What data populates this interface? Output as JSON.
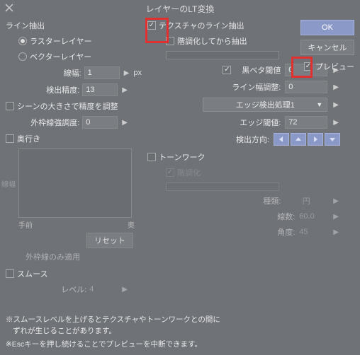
{
  "title": "レイヤーのLT変換",
  "buttons": {
    "ok": "OK",
    "cancel": "キャンセル",
    "preview": "プレビュー",
    "reset": "リセット",
    "outlineOnly": "外枠線のみ適用"
  },
  "left": {
    "section": "ライン抽出",
    "rasterLayer": "ラスターレイヤー",
    "vectorLayer": "ベクターレイヤー",
    "lineWidth": "線幅:",
    "lineWidthVal": "1",
    "lineWidthUnit": "px",
    "detectAccuracy": "検出精度:",
    "detectAccuracyVal": "13",
    "sceneSize": "シーンの大きさで精度を調整",
    "outlineStrength": "外枠線強調度:",
    "outlineStrengthVal": "0",
    "depth": "奥行き",
    "graphY": "線幅",
    "graphXLeft": "手前",
    "graphXRight": "奥",
    "smooth": "スムース",
    "level": "レベル:",
    "levelVal": "4"
  },
  "right": {
    "textureLine": "テクスチャのライン抽出",
    "gradation": "階調化してから抽出",
    "blackThreshold": "黒ベタ閾値",
    "blackThresholdVal": "0",
    "lineWidthAdj": "ライン幅調整:",
    "lineWidthAdjVal": "0",
    "edgeDetect": "エッジ検出処理1",
    "edgeThreshold": "エッジ閾値:",
    "edgeThresholdVal": "72",
    "detectDir": "検出方向:",
    "toneWork": "トーンワーク",
    "gradation2": "階調化",
    "type": "種類:",
    "typeVal": "円",
    "lineCount": "線数:",
    "lineCountVal": "60.0",
    "angle": "角度:",
    "angleVal": "45"
  },
  "footer": {
    "note1": "※スムースレベルを上げるとテクスチャやトーンワークとの間に",
    "note1b": "ずれが生じることがあります。",
    "note2": "※Escキーを押し続けることでプレビューを中断できます。"
  }
}
